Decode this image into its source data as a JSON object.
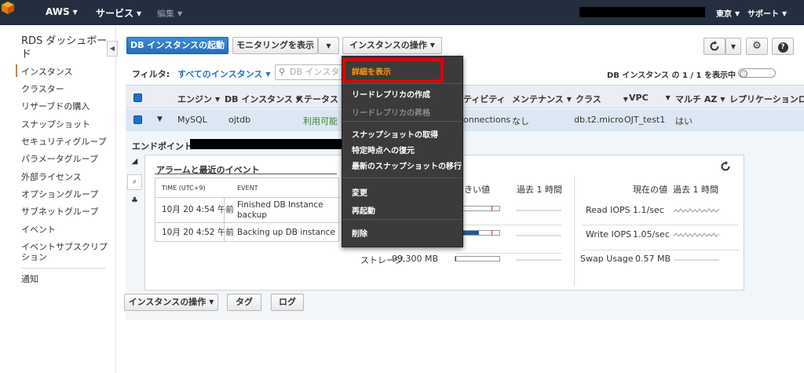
{
  "topbar": {
    "brand": "AWS",
    "services": "サービス",
    "edit": "編集",
    "region": "東京",
    "support": "サポート"
  },
  "sidebar": {
    "title": "RDS ダッシュボード",
    "items": [
      {
        "label": "インスタンス"
      },
      {
        "label": "クラスター"
      },
      {
        "label": "リザーブドの購入"
      },
      {
        "label": "スナップショット"
      },
      {
        "label": "セキュリティグループ"
      },
      {
        "label": "パラメータグループ"
      },
      {
        "label": "外部ライセンス"
      },
      {
        "label": "オプショングループ"
      },
      {
        "label": "サブネットグループ"
      },
      {
        "label": "イベント"
      },
      {
        "label": "イベントサブスクリプション"
      },
      {
        "label": "通知"
      }
    ]
  },
  "toolbar": {
    "launch": "DB インスタンスの起動",
    "monitoring": "モニタリングを表示",
    "instance_actions": "インスタンスの操作"
  },
  "filter": {
    "label": "フィルタ:",
    "selected": "すべてのインスタンス",
    "search_placeholder": "DB インスタ",
    "count": "DB インスタンス の 1 / 1 を表示中"
  },
  "table": {
    "headers": [
      "エンジン",
      "DB インスタンス",
      "ステータス",
      "ティビティ",
      "メンテナンス",
      "クラス",
      "VPC",
      "マルチ AZ",
      "レプリケーションロ"
    ],
    "row": {
      "engine": "MySQL",
      "instance": "ojtdb",
      "status": "利用可能",
      "activity": "onnections",
      "maintenance": "なし",
      "class": "db.t2.micro",
      "vpc": "OJT_test1",
      "multi_az": "はい"
    }
  },
  "detail": {
    "endpoint_label": "エンドポイント:",
    "panel_title": "アラームと最近のイベント",
    "event_headers": {
      "time": "TIME (UTC+9)",
      "event": "EVENT"
    },
    "events": [
      {
        "time": "10月 20 4:54 午前",
        "event": "Finished DB Instance backup"
      },
      {
        "time": "10月 20 4:52 午前",
        "event": "Backing up DB instance"
      }
    ],
    "metrics_mid_header_a": "きい値",
    "metrics_mid_header_b": "過去 1 時間",
    "storage_label": "ストレージ",
    "storage_value": "99,300 MB",
    "metrics_right_header_current": "現在の値",
    "metrics_right_header_past": "過去 1 時間",
    "right_metrics": [
      {
        "label": "Read IOPS",
        "value": "1.1/sec"
      },
      {
        "label": "Write IOPS",
        "value": "1.05/sec"
      },
      {
        "label": "Swap Usage",
        "value": "0.57 MB"
      }
    ],
    "bars": [
      {
        "fill": 0.02
      },
      {
        "fill": 0.48
      },
      {
        "fill": 0.02
      }
    ]
  },
  "bottom": {
    "instance_actions": "インスタンスの操作",
    "tag": "タグ",
    "log": "ログ"
  },
  "menu": {
    "items": [
      {
        "label": "詳細を表示"
      },
      {
        "label": "リードレプリカの作成"
      },
      {
        "label": "リードレプリカの昇格"
      },
      {
        "label": "スナップショットの取得"
      },
      {
        "label": "特定時点への復元"
      },
      {
        "label": "最新のスナップショットの移行"
      },
      {
        "label": "変更"
      },
      {
        "label": "再起動"
      },
      {
        "label": "削除"
      }
    ]
  },
  "colors": {
    "topbar": "#232f3e",
    "accent": "#e47911",
    "primary": "#2a6db8",
    "menu_bg": "#3b3b3b",
    "highlight": "#e00000",
    "status_ok": "#2e8b2e"
  }
}
